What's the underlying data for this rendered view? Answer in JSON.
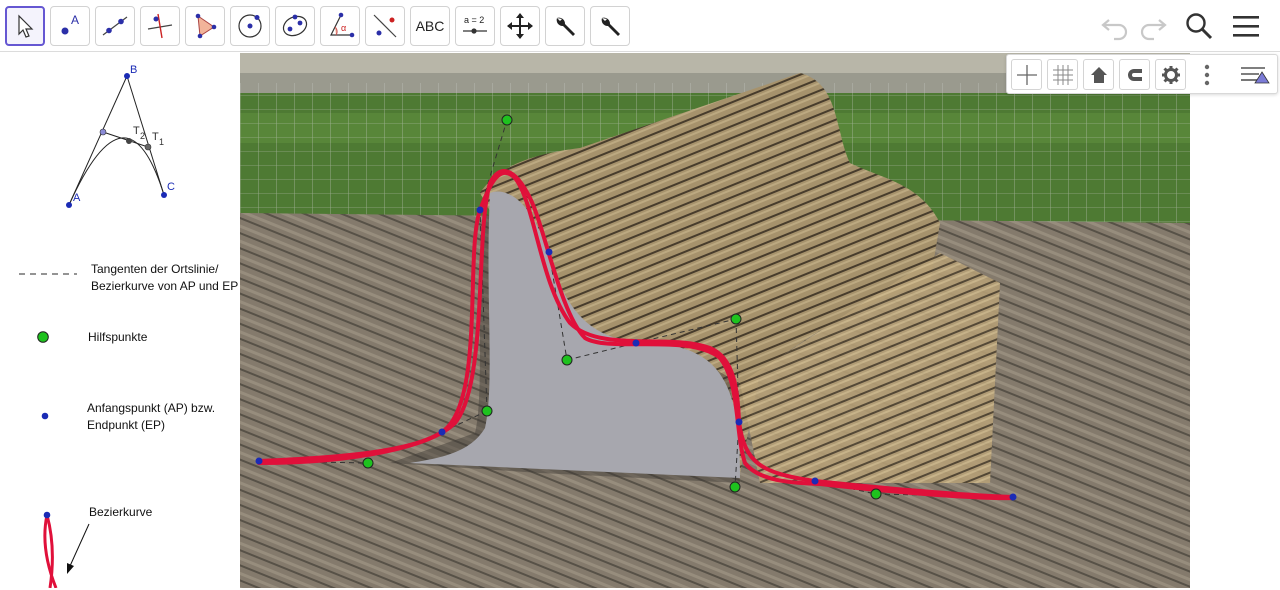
{
  "toolbar": {
    "tools": [
      {
        "name": "move-tool",
        "icon": "cursor-arrow-icon",
        "selected": true
      },
      {
        "name": "point-tool",
        "icon": "point-icon",
        "label": "A"
      },
      {
        "name": "line-tool",
        "icon": "line-icon"
      },
      {
        "name": "perpendicular-line-tool",
        "icon": "perpendicular-line-icon"
      },
      {
        "name": "polygon-tool",
        "icon": "polygon-icon"
      },
      {
        "name": "circle-tool",
        "icon": "circle-center-icon"
      },
      {
        "name": "ellipse-tool",
        "icon": "ellipse-icon"
      },
      {
        "name": "angle-tool",
        "icon": "angle-icon"
      },
      {
        "name": "reflect-tool",
        "icon": "reflect-about-line-icon"
      },
      {
        "name": "text-tool",
        "icon": "text-icon",
        "label": "ABC"
      },
      {
        "name": "slider-tool",
        "icon": "slider-icon",
        "label": "a = 2"
      },
      {
        "name": "move-graphics-view-tool",
        "icon": "move-graphics-view-icon"
      },
      {
        "name": "custom-tool-1",
        "icon": "wrench-icon"
      },
      {
        "name": "custom-tool-2",
        "icon": "wrench-icon"
      }
    ],
    "right": [
      {
        "name": "undo-button",
        "icon": "undo-icon"
      },
      {
        "name": "redo-button",
        "icon": "redo-icon"
      },
      {
        "name": "search-button",
        "icon": "search-icon"
      },
      {
        "name": "menu-button",
        "icon": "hamburger-menu-icon"
      }
    ]
  },
  "style_bar": {
    "buttons": [
      "axes-toggle-icon",
      "grid-toggle-icon",
      "home-icon",
      "magnet-snap-icon",
      "gear-icon",
      "more-vertical-icon",
      "toggle-style-bar-icon"
    ]
  },
  "legend": {
    "construction_labels": {
      "a": "A",
      "b": "B",
      "c": "C",
      "t2": "T",
      "t2_sub": "2",
      "t1": "T",
      "t1_sub": "1"
    },
    "tangent_text_1": "Tangenten der Ortslinie/",
    "tangent_text_2": "Bezierkurve von AP und EP",
    "helper_points_text": "Hilfspunkte",
    "endpoint_text_1": "Anfangspunkt (AP) bzw.",
    "endpoint_text_2": "Endpunkt (EP)",
    "bezier_text": "Bezierkurve"
  },
  "colors": {
    "selected_tool": "#6557d2",
    "bezier_curve": "#e0103a",
    "helper_point": "#1ec21e",
    "endpoint": "#1a2bb5",
    "fill_shape": "#a7a7ae"
  }
}
